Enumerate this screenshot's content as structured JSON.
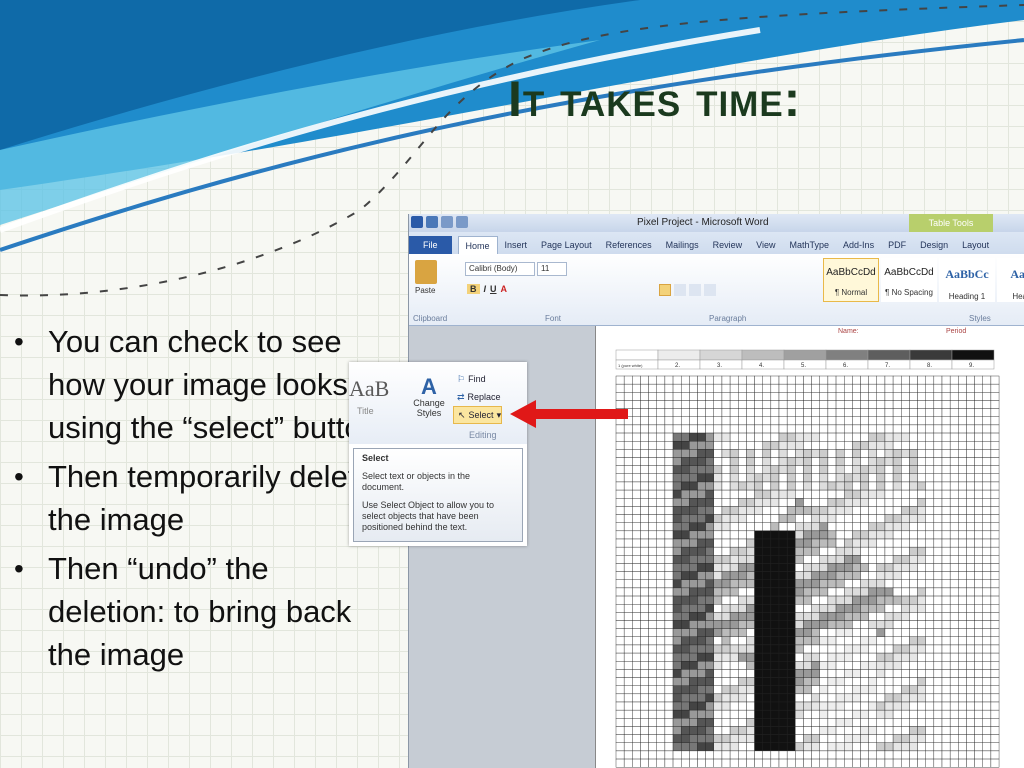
{
  "slide": {
    "title": "It takes time:",
    "bullets": [
      "You can check to see how your image looks by using the “select” button",
      "Then temporarily delete the image",
      "Then “undo” the deletion: to bring back the image"
    ]
  },
  "word": {
    "window_title": "Pixel Project - Microsoft Word",
    "contextual_tab": "Table Tools",
    "tabs": [
      "File",
      "Home",
      "Insert",
      "Page Layout",
      "References",
      "Mailings",
      "Review",
      "View",
      "MathType",
      "Add-Ins",
      "PDF",
      "Design",
      "Layout"
    ],
    "font_name": "Calibri (Body)",
    "font_size": "11",
    "paste_label": "Paste",
    "groups": {
      "clipboard": "Clipboard",
      "font": "Font",
      "paragraph": "Paragraph",
      "styles": "Styles"
    },
    "styles": [
      {
        "sample": "AaBbCcDd",
        "name": "¶ Normal"
      },
      {
        "sample": "AaBbCcDd",
        "name": "¶ No Spacing"
      },
      {
        "sample": "AaBbCc",
        "name": "Heading 1"
      },
      {
        "sample": "AaBb",
        "name": "Headin"
      }
    ],
    "doc": {
      "name_label": "Name:",
      "period_label": "Period",
      "scale_labels": [
        "1 (pure white)",
        "2.",
        "3.",
        "4.",
        "5.",
        "6.",
        "7.",
        "8.",
        "9."
      ],
      "scale_colors": [
        "#ffffff",
        "#ececec",
        "#d6d6d6",
        "#bdbdbd",
        "#a0a0a0",
        "#808080",
        "#5e5e5e",
        "#3a3a3a",
        "#111111"
      ]
    }
  },
  "callout": {
    "style_sample": "AaB",
    "style_name": "Title",
    "change_styles": "Change Styles",
    "find": "Find",
    "replace": "Replace",
    "select": "Select",
    "editing": "Editing",
    "tooltip_title": "Select",
    "tooltip_line1": "Select text or objects in the document.",
    "tooltip_line2": "Use Select Object to allow you to select objects that have been positioned behind the text."
  },
  "colors": {
    "title": "#1b3a1e",
    "swoosh_dark": "#1676b8",
    "swoosh_light": "#5fc4e6",
    "arrow": "#e01818",
    "file_tab": "#2a5aa8"
  }
}
